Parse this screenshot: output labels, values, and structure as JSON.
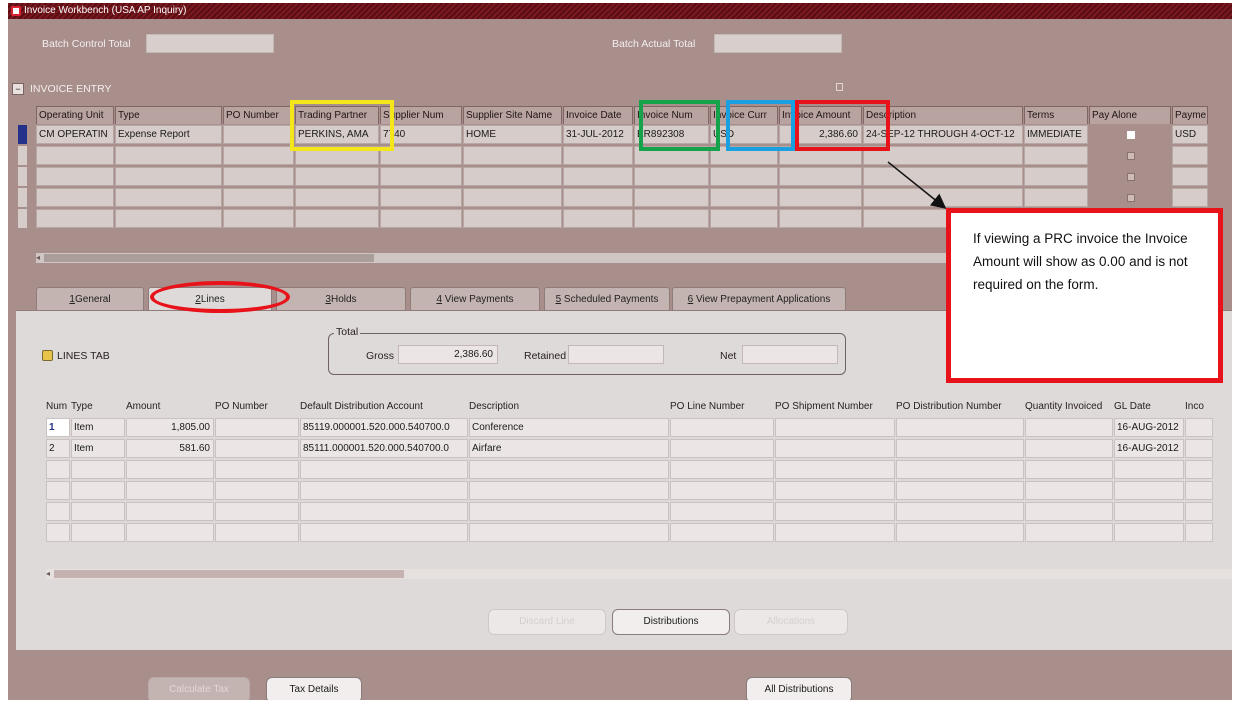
{
  "window": {
    "title": "Invoice Workbench (USA AP Inquiry)"
  },
  "batch": {
    "control_total_label": "Batch Control Total",
    "actual_total_label": "Batch Actual Total"
  },
  "invoice_entry": {
    "section_label": "INVOICE ENTRY",
    "columns": [
      "Operating Unit",
      "Type",
      "PO Number",
      "Trading Partner",
      "Supplier Num",
      "Supplier Site Name",
      "Invoice Date",
      "Invoice Num",
      "Invoice Curr",
      "Invoice Amount",
      "Description",
      "Terms",
      "Pay Alone",
      "Payme"
    ],
    "row": {
      "operating_unit": "CM OPERATIN",
      "type": "Expense Report",
      "po_number": "",
      "trading_partner": "PERKINS, AMA",
      "supplier_num": "7740",
      "supplier_site_name": "HOME",
      "invoice_date": "31-JUL-2012",
      "invoice_num": "ER892308",
      "invoice_curr": "USD",
      "invoice_amount": "2,386.60",
      "description": "24-SEP-12 THROUGH 4-OCT-12",
      "terms": "IMMEDIATE",
      "payment_curr": "USD"
    }
  },
  "tabs": [
    {
      "num": "1",
      "label": "General"
    },
    {
      "num": "2",
      "label": "Lines"
    },
    {
      "num": "3",
      "label": "Holds"
    },
    {
      "num": "4",
      "label": "View Payments"
    },
    {
      "num": "5",
      "label": "Scheduled Payments"
    },
    {
      "num": "6",
      "label": "View Prepayment Applications"
    }
  ],
  "lines_tab": {
    "label": "LINES TAB",
    "total_label": "Total",
    "gross_label": "Gross",
    "gross_value": "2,386.60",
    "retained_label": "Retained",
    "net_label": "Net",
    "columns": [
      "Num",
      "Type",
      "Amount",
      "PO Number",
      "Default Distribution Account",
      "Description",
      "PO Line Number",
      "PO Shipment Number",
      "PO Distribution Number",
      "Quantity Invoiced",
      "GL Date",
      "Inco"
    ],
    "rows": [
      {
        "num": "1",
        "type": "Item",
        "amount": "1,805.00",
        "po_number": "",
        "account": "85119.000001.520.000.540700.0",
        "description": "Conference",
        "gl_date": "16-AUG-2012"
      },
      {
        "num": "2",
        "type": "Item",
        "amount": "581.60",
        "po_number": "",
        "account": "85111.000001.520.000.540700.0",
        "description": "Airfare",
        "gl_date": "16-AUG-2012"
      }
    ]
  },
  "buttons": {
    "discard_line": "Discard Line",
    "distributions": "Distributions",
    "allocations": "Allocations",
    "calculate_tax": "Calculate Tax",
    "tax_details": "Tax Details",
    "all_distributions": "All Distributions"
  },
  "annotation": {
    "callout_text": "If viewing a PRC invoice the Invoice Amount will show as 0.00 and is not required on the form.",
    "colors": {
      "yellow": "#f5e61a",
      "green": "#14a34a",
      "blue": "#1a9fe0",
      "red": "#e8121a"
    }
  }
}
